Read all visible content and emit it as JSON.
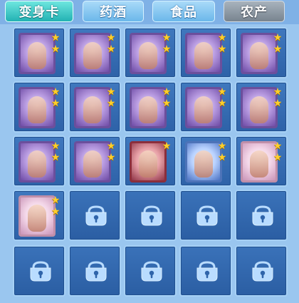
{
  "tabs": [
    {
      "label": "变身卡",
      "active": true
    },
    {
      "label": "药酒",
      "active": false
    },
    {
      "label": "食品",
      "active": false
    },
    {
      "label": "农产",
      "active": false
    }
  ],
  "slots": [
    {
      "row": 1,
      "col": 1,
      "type": "card",
      "stars": 2,
      "theme": "purple",
      "icon": "costume-card-dark-ninja"
    },
    {
      "row": 1,
      "col": 2,
      "type": "card",
      "stars": 2,
      "theme": "purple",
      "icon": "costume-card-dark-knight"
    },
    {
      "row": 1,
      "col": 3,
      "type": "card",
      "stars": 2,
      "theme": "purple",
      "icon": "costume-card-demon-warrior"
    },
    {
      "row": 1,
      "col": 4,
      "type": "card",
      "stars": 2,
      "theme": "purple",
      "icon": "costume-card-demon-warrior"
    },
    {
      "row": 1,
      "col": 5,
      "type": "card",
      "stars": 2,
      "theme": "purple",
      "icon": "costume-card-mage"
    },
    {
      "row": 2,
      "col": 1,
      "type": "card",
      "stars": 2,
      "theme": "purple",
      "icon": "costume-card-bunny-warrior"
    },
    {
      "row": 2,
      "col": 2,
      "type": "card",
      "stars": 2,
      "theme": "purple",
      "icon": "costume-card-fire-warrior"
    },
    {
      "row": 2,
      "col": 3,
      "type": "card",
      "stars": 2,
      "theme": "purple",
      "icon": "costume-card-winged-demon"
    },
    {
      "row": 2,
      "col": 4,
      "type": "card",
      "stars": 2,
      "theme": "purple",
      "icon": "costume-card-winged-demon"
    },
    {
      "row": 2,
      "col": 5,
      "type": "card",
      "stars": 2,
      "theme": "purple",
      "icon": "costume-card-red-fighter"
    },
    {
      "row": 3,
      "col": 1,
      "type": "card",
      "stars": 2,
      "theme": "purple",
      "icon": "costume-card-red-fighter"
    },
    {
      "row": 3,
      "col": 2,
      "type": "card",
      "stars": 2,
      "theme": "purple",
      "icon": "costume-card-golden-warrior"
    },
    {
      "row": 3,
      "col": 3,
      "type": "card",
      "stars": 1,
      "theme": "red",
      "icon": "costume-card-blue-robot"
    },
    {
      "row": 3,
      "col": 4,
      "type": "card",
      "stars": 2,
      "theme": "blue",
      "icon": "costume-card-ice-dragon"
    },
    {
      "row": 3,
      "col": 5,
      "type": "card",
      "stars": 2,
      "theme": "pink",
      "icon": "costume-card-pink-girl"
    },
    {
      "row": 4,
      "col": 1,
      "type": "card",
      "stars": 2,
      "theme": "pink",
      "icon": "costume-card-pink-girl"
    },
    {
      "row": 4,
      "col": 2,
      "type": "locked",
      "icon": "lock-icon"
    },
    {
      "row": 4,
      "col": 3,
      "type": "locked",
      "icon": "lock-icon"
    },
    {
      "row": 4,
      "col": 4,
      "type": "locked",
      "icon": "lock-icon"
    },
    {
      "row": 4,
      "col": 5,
      "type": "locked",
      "icon": "lock-icon"
    },
    {
      "row": 5,
      "col": 1,
      "type": "locked",
      "icon": "lock-icon"
    },
    {
      "row": 5,
      "col": 2,
      "type": "locked",
      "icon": "lock-icon"
    },
    {
      "row": 5,
      "col": 3,
      "type": "locked",
      "icon": "lock-icon"
    },
    {
      "row": 5,
      "col": 4,
      "type": "locked",
      "icon": "lock-icon"
    },
    {
      "row": 5,
      "col": 5,
      "type": "locked",
      "icon": "lock-icon"
    }
  ],
  "colors": {
    "tab_active": "#2cc3c3",
    "tab_normal": "#82c3f0",
    "tab_gray": "#8f9aa5",
    "slot_bg": "#356db4",
    "star": "#ffcf2a"
  }
}
